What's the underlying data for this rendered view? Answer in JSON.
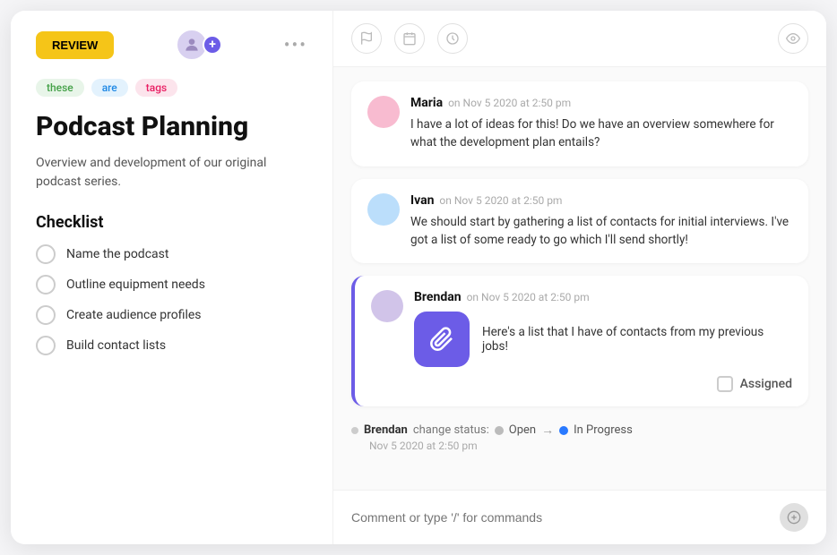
{
  "app": {
    "title": "Podcast Planning"
  },
  "toolbar": {
    "review_label": "REVIEW"
  },
  "tags": [
    {
      "label": "these",
      "class": "tag-these"
    },
    {
      "label": "are",
      "class": "tag-are"
    },
    {
      "label": "tags",
      "class": "tag-tags"
    }
  ],
  "left": {
    "title": "Podcast Planning",
    "description": "Overview and development of our original podcast series.",
    "checklist_title": "Checklist",
    "checklist_items": [
      "Name the podcast",
      "Outline equipment needs",
      "Create audience profiles",
      "Build contact lists"
    ]
  },
  "right": {
    "messages": [
      {
        "author": "Maria",
        "time": "on Nov 5 2020 at 2:50 pm",
        "text": "I have a lot of ideas for this! Do we have an overview somewhere for what the development plan entails?",
        "highlighted": false
      },
      {
        "author": "Ivan",
        "time": "on Nov 5 2020 at 2:50 pm",
        "text": "We should start by gathering a list of contacts for initial interviews. I've got a list of some ready to go which I'll send shortly!",
        "highlighted": false
      },
      {
        "author": "Brendan",
        "time": "on Nov 5 2020 at 2:50 pm",
        "text": "Here's a list that I have of contacts from my previous jobs!",
        "highlighted": true,
        "has_attachment": true,
        "assigned_label": "Assigned"
      }
    ],
    "status_change": {
      "author": "Brendan",
      "label": "change status:",
      "from": "Open",
      "to": "In Progress",
      "date": "Nov 5 2020 at 2:50 pm"
    },
    "comment_placeholder": "Comment or type '/' for commands"
  },
  "icons": {
    "flag": "⚑",
    "calendar": "▭",
    "clock": "◷",
    "eye": "◉",
    "attachment": "🔗",
    "more": "•••"
  }
}
